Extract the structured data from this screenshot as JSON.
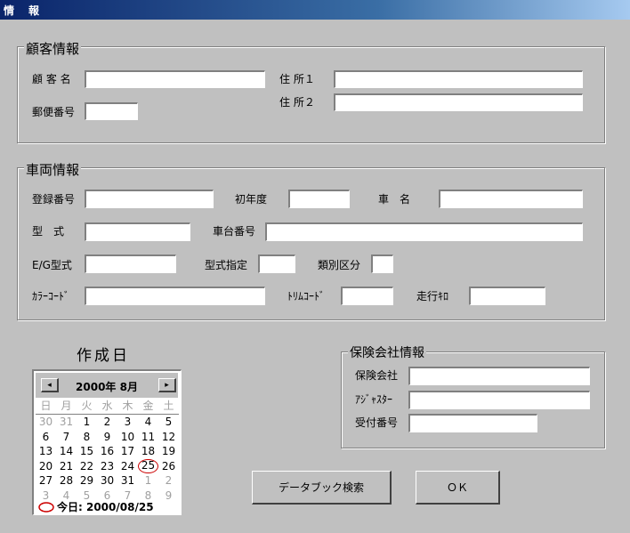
{
  "window": {
    "title": "情　報"
  },
  "customer": {
    "legend": "顧客情報",
    "name_label": "顧 客 名",
    "name_value": "",
    "zip_label": "郵便番号",
    "zip_value": "",
    "addr1_label": "住 所１",
    "addr1_value": "",
    "addr2_label": "住 所２",
    "addr2_value": ""
  },
  "vehicle": {
    "legend": "車両情報",
    "reg_label": "登録番号",
    "first_year_label": "初年度",
    "car_name_label": "車　名",
    "model_label": "型　式",
    "chassis_label": "車台番号",
    "engine_label": "E/G型式",
    "model_spec_label": "型式指定",
    "class_label": "類別区分",
    "color_label": "ｶﾗｰｺｰﾄﾞ",
    "trim_label": "ﾄﾘﾑｺｰﾄﾞ",
    "mileage_label": "走行ｷﾛ"
  },
  "created": {
    "label": "作成日"
  },
  "calendar": {
    "prev_icon": "◂",
    "next_icon": "▸",
    "header": "2000年 8月",
    "weekdays": [
      "日",
      "月",
      "火",
      "水",
      "木",
      "金",
      "土"
    ],
    "days": [
      {
        "d": "30",
        "m": "o"
      },
      {
        "d": "31",
        "m": "o"
      },
      {
        "d": "1",
        "m": "c"
      },
      {
        "d": "2",
        "m": "c"
      },
      {
        "d": "3",
        "m": "c"
      },
      {
        "d": "4",
        "m": "c"
      },
      {
        "d": "5",
        "m": "c"
      },
      {
        "d": "6",
        "m": "c"
      },
      {
        "d": "7",
        "m": "c"
      },
      {
        "d": "8",
        "m": "c"
      },
      {
        "d": "9",
        "m": "c"
      },
      {
        "d": "10",
        "m": "c"
      },
      {
        "d": "11",
        "m": "c"
      },
      {
        "d": "12",
        "m": "c"
      },
      {
        "d": "13",
        "m": "c"
      },
      {
        "d": "14",
        "m": "c"
      },
      {
        "d": "15",
        "m": "c"
      },
      {
        "d": "16",
        "m": "c"
      },
      {
        "d": "17",
        "m": "c"
      },
      {
        "d": "18",
        "m": "c"
      },
      {
        "d": "19",
        "m": "c"
      },
      {
        "d": "20",
        "m": "c"
      },
      {
        "d": "21",
        "m": "c"
      },
      {
        "d": "22",
        "m": "c"
      },
      {
        "d": "23",
        "m": "c"
      },
      {
        "d": "24",
        "m": "c"
      },
      {
        "d": "25",
        "m": "t"
      },
      {
        "d": "26",
        "m": "c"
      },
      {
        "d": "27",
        "m": "c"
      },
      {
        "d": "28",
        "m": "c"
      },
      {
        "d": "29",
        "m": "c"
      },
      {
        "d": "30",
        "m": "c"
      },
      {
        "d": "31",
        "m": "c"
      },
      {
        "d": "1",
        "m": "o"
      },
      {
        "d": "2",
        "m": "o"
      },
      {
        "d": "3",
        "m": "o"
      },
      {
        "d": "4",
        "m": "o"
      },
      {
        "d": "5",
        "m": "o"
      },
      {
        "d": "6",
        "m": "o"
      },
      {
        "d": "7",
        "m": "o"
      },
      {
        "d": "8",
        "m": "o"
      },
      {
        "d": "9",
        "m": "o"
      }
    ],
    "today_text": "今日: 2000/08/25",
    "today_color": "#cc0000"
  },
  "insurance": {
    "legend": "保険会社情報",
    "company_label": "保険会社",
    "adjuster_label": "ｱｼﾞｬｽﾀｰ",
    "number_label": "受付番号"
  },
  "buttons": {
    "search": "データブック検索",
    "ok": "ＯＫ"
  }
}
